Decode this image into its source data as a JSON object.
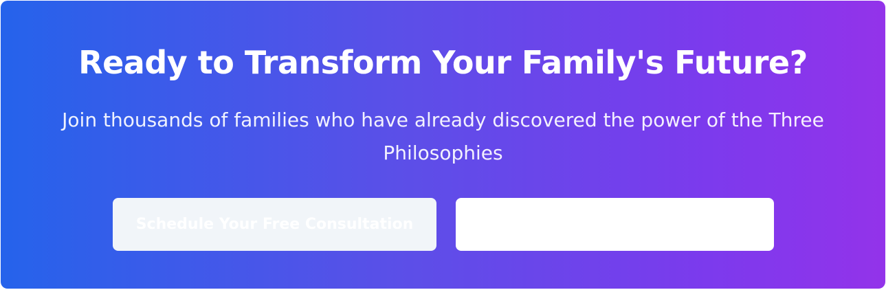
{
  "cta": {
    "title": "Ready to Transform Your Family's Future?",
    "subtitle": "Join thousands of families who have already discovered the power of the Three Philosophies",
    "primary_button_label": "Schedule Your Free Consultation",
    "secondary_button_label": ""
  },
  "colors": {
    "gradient_start": "#2563eb",
    "gradient_end": "#9333ea",
    "primary_button_bg": "#f1f5f9",
    "secondary_button_bg": "#ffffff"
  }
}
